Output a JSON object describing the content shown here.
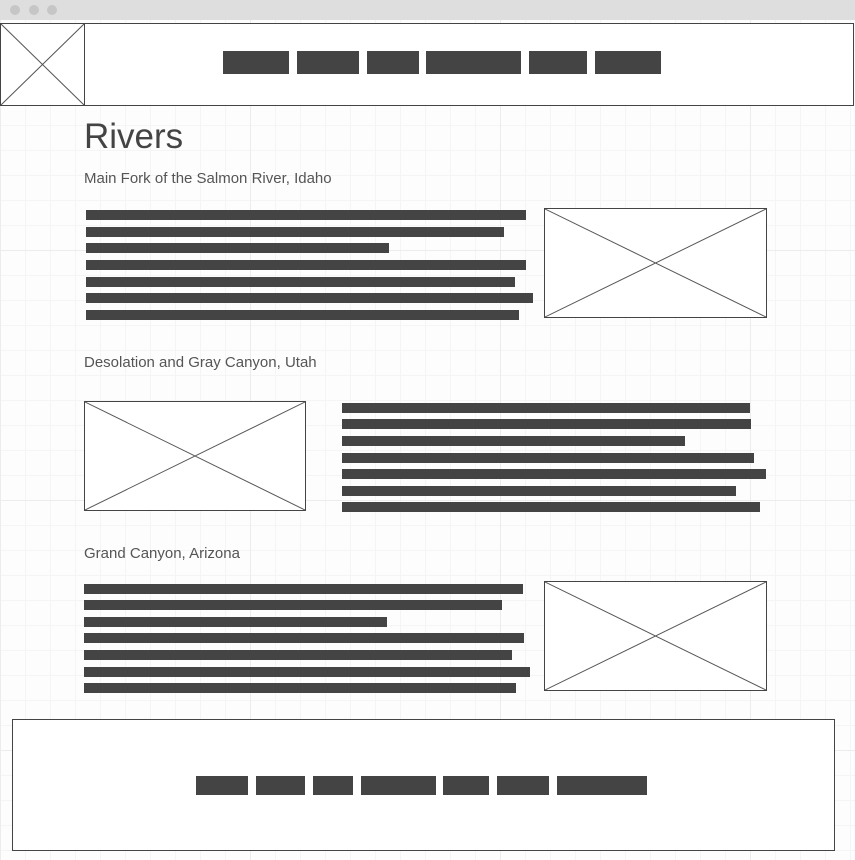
{
  "page": {
    "title": "Rivers"
  },
  "header": {
    "logo_icon": "image-placeholder-icon",
    "nav_items": 6
  },
  "sections": [
    {
      "heading": "Main Fork of the Salmon River, Idaho",
      "image_icon": "image-placeholder-icon"
    },
    {
      "heading": "Desolation and Gray Canyon, Utah",
      "image_icon": "image-placeholder-icon"
    },
    {
      "heading": "Grand Canyon, Arizona",
      "image_icon": "image-placeholder-icon"
    }
  ],
  "footer": {
    "nav_items": 7
  },
  "colors": {
    "wireframe_dark": "#444444",
    "titlebar": "#dedede",
    "grid": "#ececec"
  }
}
